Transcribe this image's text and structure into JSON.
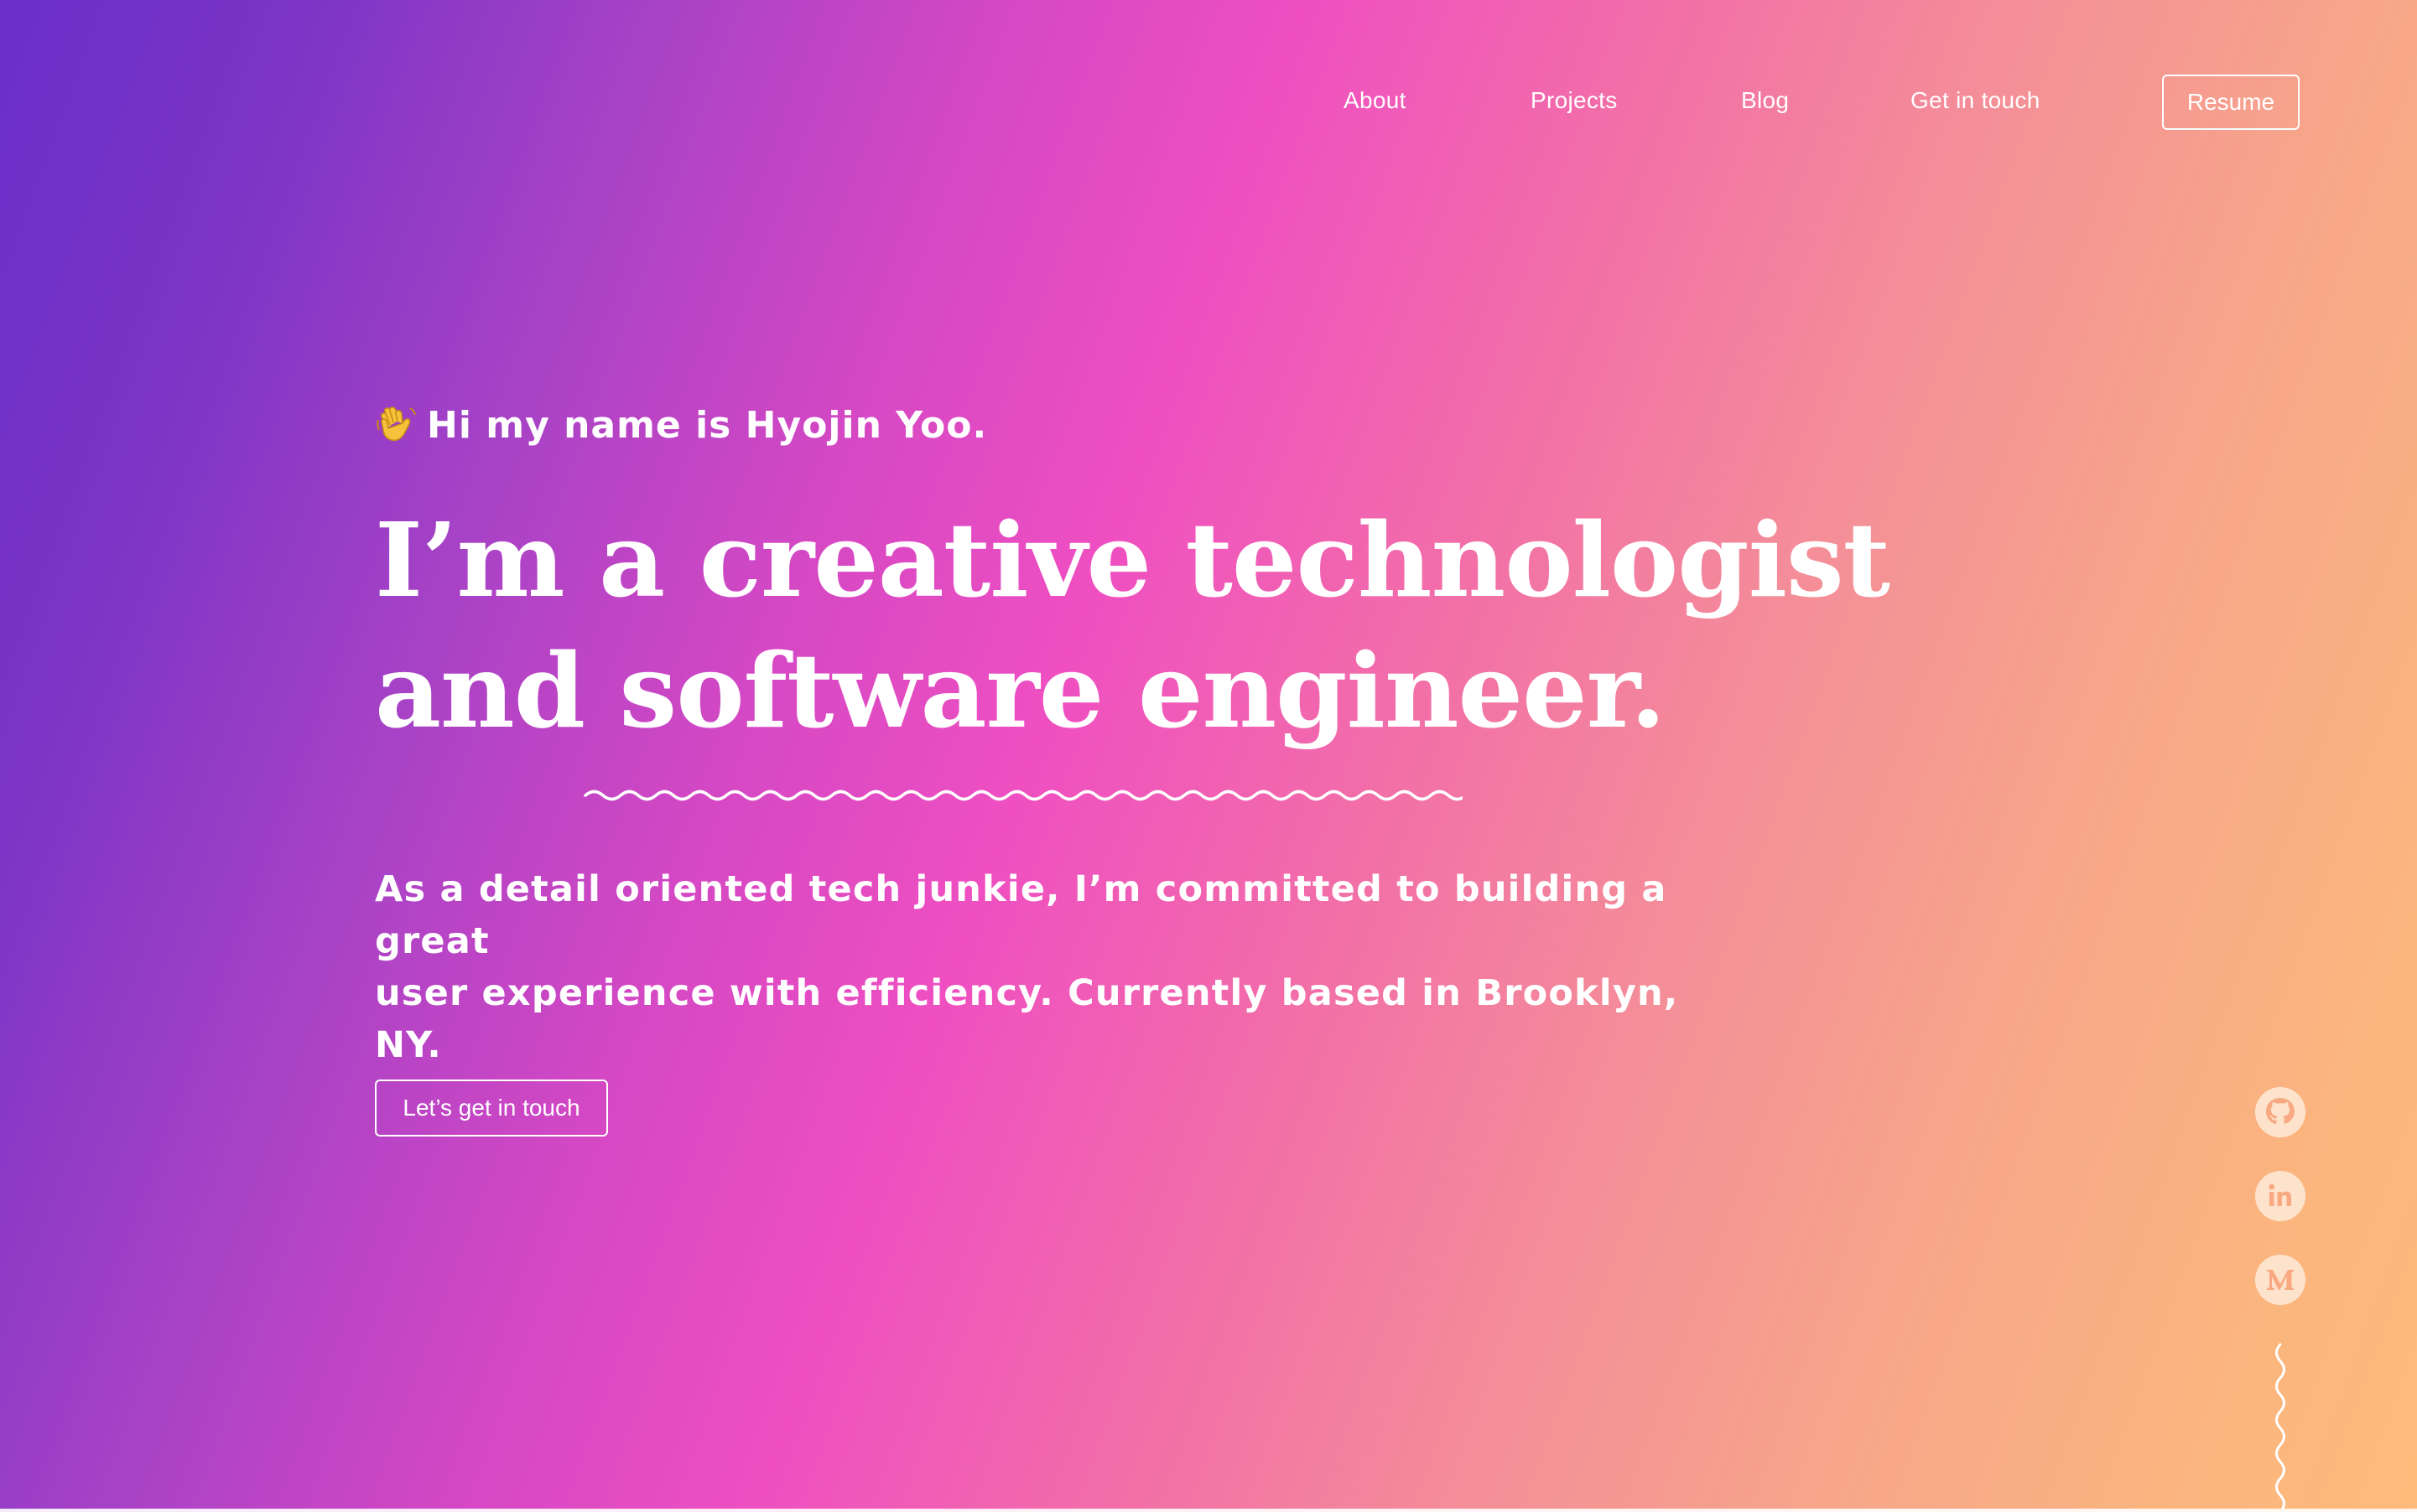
{
  "nav": {
    "links": [
      "About",
      "Projects",
      "Blog",
      "Get in touch"
    ],
    "resume_label": "Resume"
  },
  "hero": {
    "greeting_icon": "waving-hand-icon",
    "greeting": "Hi my name is Hyojin Yoo.",
    "headline_line1": "I’m a creative technologist",
    "headline_line2": "and software engineer.",
    "intro_line1": "As a detail oriented tech junkie, I’m committed to building a great",
    "intro_line2": "user experience with efficiency. Currently based in Brooklyn, NY.",
    "cta_label": "Let’s get in touch"
  },
  "social": {
    "icons": [
      "github-icon",
      "linkedin-icon",
      "medium-icon"
    ]
  },
  "colors": {
    "gradient_start": "#6a2fc8",
    "gradient_mid": "#ef4fc1",
    "gradient_end": "#fcbb7b",
    "text": "#ffffff",
    "social_icon": "#fde3cc"
  }
}
